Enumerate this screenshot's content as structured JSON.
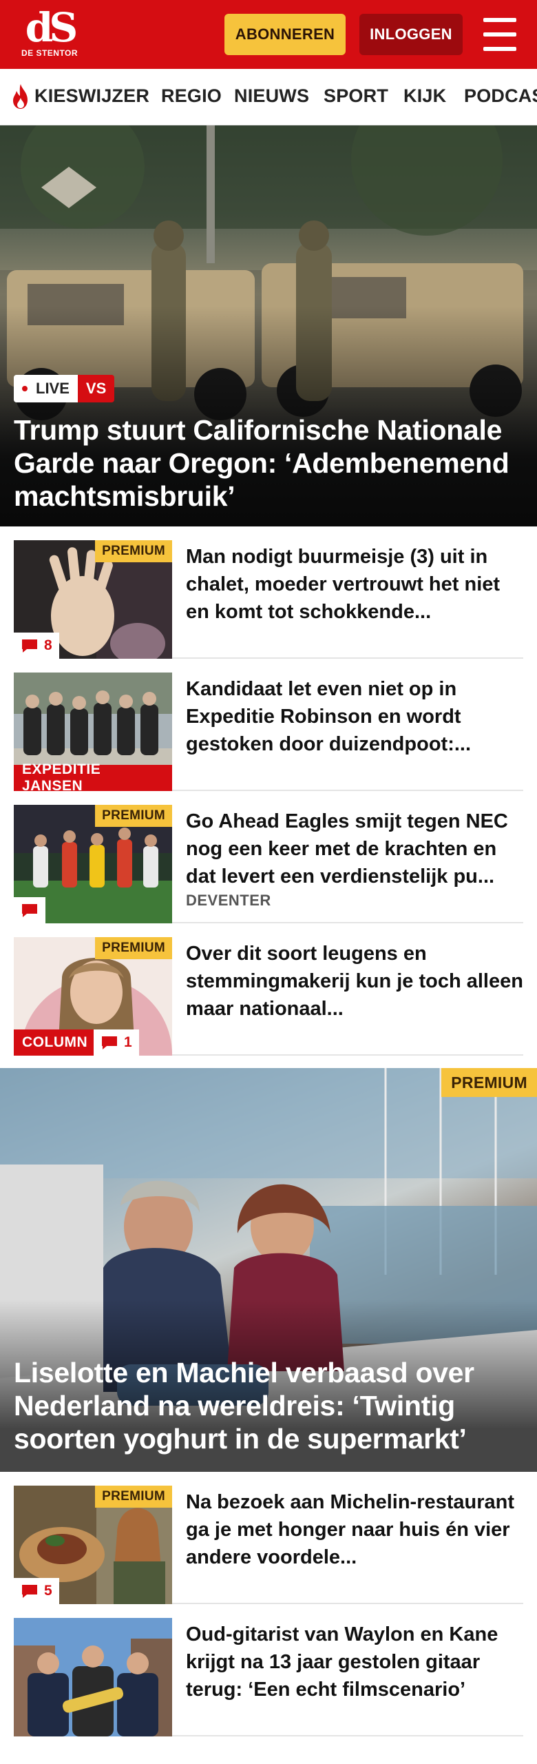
{
  "header": {
    "logo_mark": "dS",
    "logo_sub": "DE STENTOR",
    "subscribe_label": "ABONNEREN",
    "login_label": "INLOGGEN",
    "brand_color": "#d50d12",
    "subscribe_color": "#f6c33c"
  },
  "nav": {
    "items": [
      {
        "label": "KIESWIJZER",
        "icon": "flame-icon"
      },
      {
        "label": "REGIO"
      },
      {
        "label": "NIEUWS"
      },
      {
        "label": "SPORT"
      },
      {
        "label": "KIJK"
      },
      {
        "label": "PODCAS"
      }
    ]
  },
  "hero": {
    "live_label": "LIVE",
    "tag": "VS",
    "title": "Trump stuurt Californische Nationale Garde naar Oregon: ‘Adembenemend machtsmisbruik’"
  },
  "articles": [
    {
      "title": "Man nodigt buurmeisje (3) uit in chalet, moeder vertrouwt het niet en komt tot schokkende...",
      "premium": "PREMIUM",
      "comments": "8"
    },
    {
      "title": "Kandidaat let even niet op in Expeditie Robinson en wordt gestoken door duizendpoot:...",
      "label": "EXPEDITIE JANSEN"
    },
    {
      "title": "Go Ahead Eagles smijt tegen NEC nog een keer met de krachten en dat levert een verdienstelijk pu...",
      "premium": "PREMIUM",
      "meta": "DEVENTER"
    },
    {
      "title": "Over dit soort leugens en stemmingmakerij kun je toch alleen maar nationaal...",
      "premium": "PREMIUM",
      "label": "COLUMN",
      "comments": "1"
    }
  ],
  "feature": {
    "premium": "PREMIUM",
    "title": "Liselotte en Machiel verbaasd over Nederland na wereldreis: ‘Twintig soorten yoghurt in de supermarkt’"
  },
  "articles2": [
    {
      "title": "Na bezoek aan Michelin-restaurant ga je met honger naar huis én vier andere voordele...",
      "premium": "PREMIUM",
      "comments": "5"
    },
    {
      "title": "Oud-gitarist van Waylon en Kane krijgt na 13 jaar gestolen gitaar terug: ‘Een echt filmscenario’"
    }
  ]
}
